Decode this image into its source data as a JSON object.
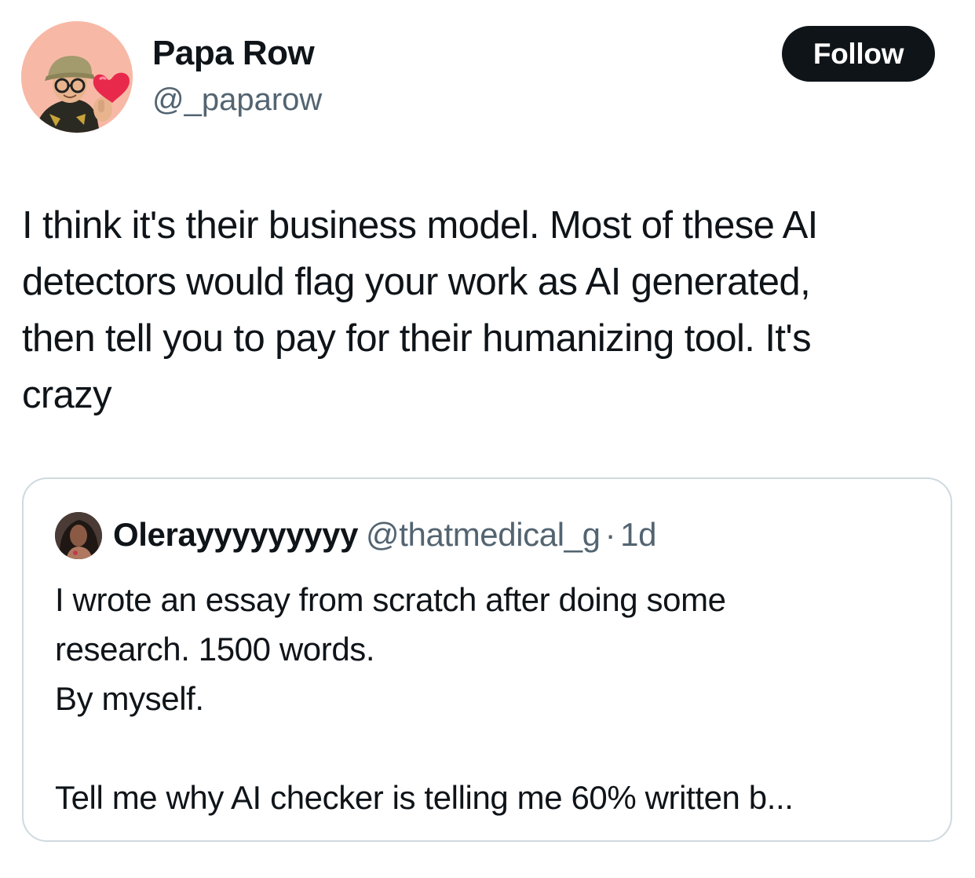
{
  "author": {
    "display_name": "Papa Row",
    "handle": "@_paparow",
    "avatar_icon": "cartoon-avatar-finger-heart-icon"
  },
  "follow_button": {
    "label": "Follow"
  },
  "tweet": {
    "lines": [
      "I think it's their business model. Most of these AI",
      "detectors would flag your work as AI generated,",
      "then tell you to pay for their humanizing tool. It's",
      "crazy"
    ]
  },
  "quoted_tweet": {
    "display_name": "Olerayyyyyyyyy",
    "handle": "@thatmedical_g",
    "separator": "·",
    "time": "1d",
    "lines": [
      "I wrote an essay from scratch after doing some",
      "research. 1500 words.",
      "By myself.",
      "",
      "Tell me why AI checker is telling me 60% written b..."
    ]
  },
  "colors": {
    "text": "#0f1419",
    "secondary_text": "#536471",
    "border": "#cfd9de",
    "button_bg": "#0f1419",
    "button_text": "#ffffff"
  }
}
